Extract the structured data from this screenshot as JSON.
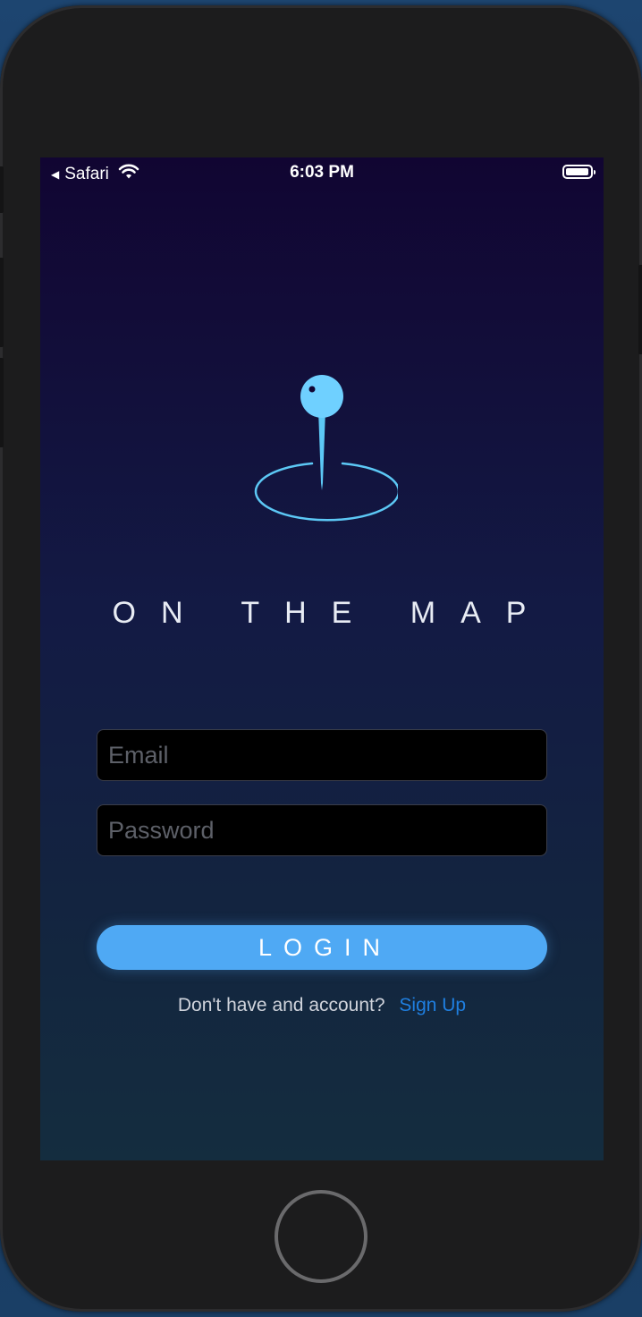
{
  "status_bar": {
    "back_app": "Safari",
    "time": "6:03 PM"
  },
  "app": {
    "title": "ON THE MAP",
    "accent_color": "#4fa9f4",
    "logo_icon": "map-pin-icon"
  },
  "form": {
    "email_placeholder": "Email",
    "email_value": "",
    "password_placeholder": "Password",
    "password_value": "",
    "login_label": "LOGIN"
  },
  "signup": {
    "prompt": "Don't have and account?",
    "link_label": "Sign Up",
    "link_color": "#1f7fe0"
  }
}
